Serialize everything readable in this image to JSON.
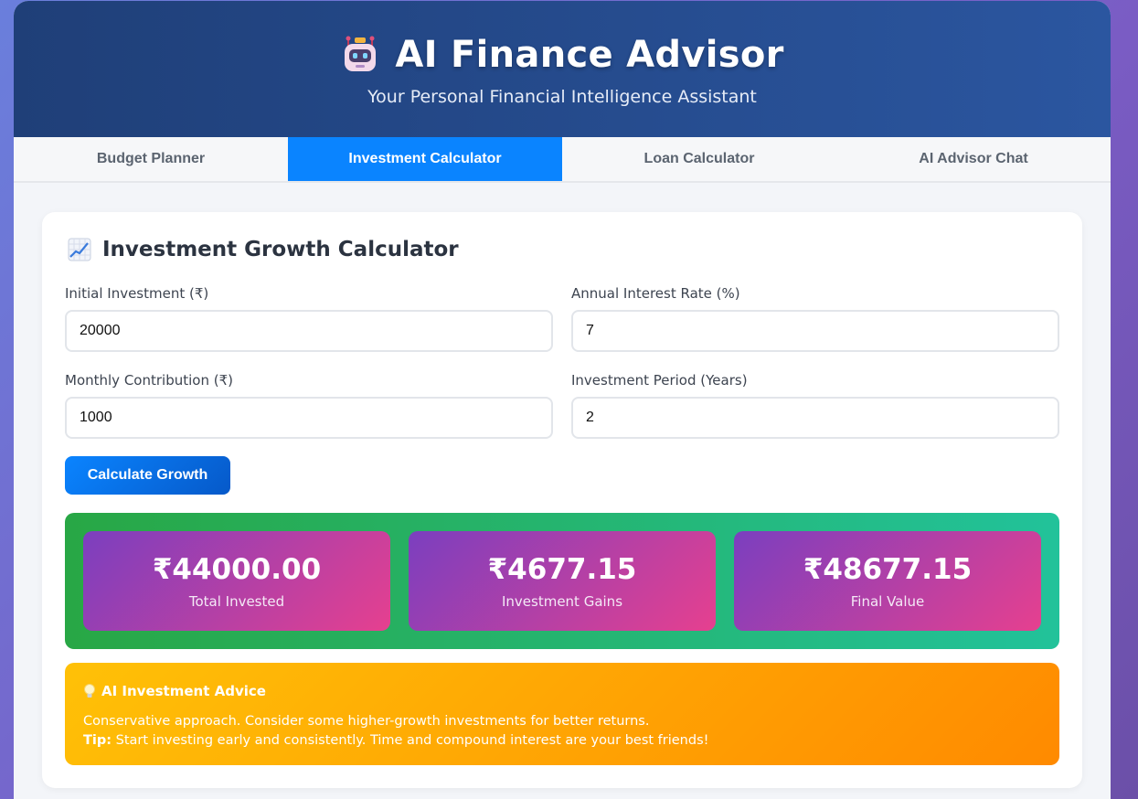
{
  "header": {
    "title": "AI Finance Advisor",
    "subtitle": "Your Personal Financial Intelligence Assistant",
    "icon": "robot-icon"
  },
  "tabs": [
    {
      "label": "Budget Planner",
      "active": false
    },
    {
      "label": "Investment Calculator",
      "active": true
    },
    {
      "label": "Loan Calculator",
      "active": false
    },
    {
      "label": "AI Advisor Chat",
      "active": false
    }
  ],
  "calculator": {
    "title": "Investment Growth Calculator",
    "title_icon": "chart-increasing-icon",
    "fields": {
      "initial": {
        "label": "Initial Investment (₹)",
        "value": "20000"
      },
      "rate": {
        "label": "Annual Interest Rate (%)",
        "value": "7"
      },
      "monthly": {
        "label": "Monthly Contribution (₹)",
        "value": "1000"
      },
      "period": {
        "label": "Investment Period (Years)",
        "value": "2"
      }
    },
    "button_label": "Calculate Growth"
  },
  "results": [
    {
      "value": "₹44000.00",
      "label": "Total Invested"
    },
    {
      "value": "₹4677.15",
      "label": "Investment Gains"
    },
    {
      "value": "₹48677.15",
      "label": "Final Value"
    }
  ],
  "advice": {
    "icon": "lightbulb-icon",
    "title": "AI Investment Advice",
    "line1": "Conservative approach. Consider some higher-growth investments for better returns.",
    "tip_label": "Tip:",
    "tip_text": " Start investing early and consistently. Time and compound interest are your best friends!"
  },
  "colors": {
    "header": "#1f3f78",
    "active_tab": "#0a84ff",
    "results_bg": "#28a745",
    "result_box": "#7b3fbf",
    "advice_bg": "#ffc107"
  }
}
